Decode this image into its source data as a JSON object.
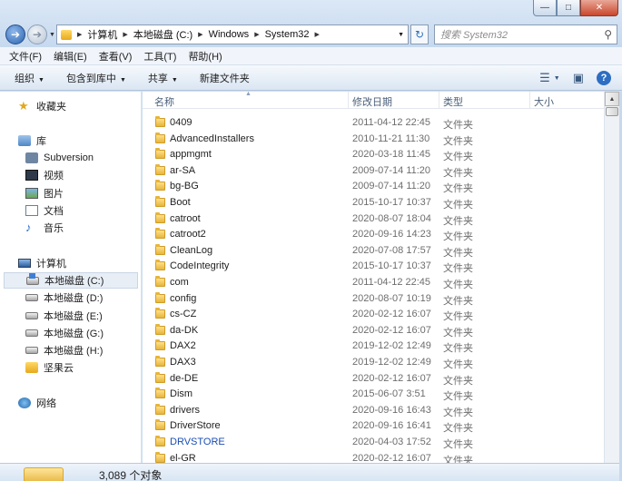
{
  "window": {
    "min_icon": "minimize-icon",
    "max_icon": "maximize-icon",
    "close_icon": "close-icon"
  },
  "address": {
    "crumbs": [
      "计算机",
      "本地磁盘 (C:)",
      "Windows",
      "System32"
    ]
  },
  "search": {
    "placeholder": "搜索 System32"
  },
  "menu": [
    "文件(F)",
    "编辑(E)",
    "查看(V)",
    "工具(T)",
    "帮助(H)"
  ],
  "commands": {
    "organize": "组织",
    "include": "包含到库中",
    "share": "共享",
    "new_folder": "新建文件夹"
  },
  "nav": {
    "favorites": "收藏夹",
    "libraries": "库",
    "lib_items": [
      "Subversion",
      "视频",
      "图片",
      "文档",
      "音乐"
    ],
    "computer": "计算机",
    "drives": [
      "本地磁盘 (C:)",
      "本地磁盘 (D:)",
      "本地磁盘 (E:)",
      "本地磁盘 (G:)",
      "本地磁盘 (H:)"
    ],
    "jianguo": "坚果云",
    "network": "网络"
  },
  "columns": {
    "name": "名称",
    "date": "修改日期",
    "type": "类型",
    "size": "大小"
  },
  "files": [
    {
      "name": "0409",
      "date": "2011-04-12 22:45",
      "type": "文件夹"
    },
    {
      "name": "AdvancedInstallers",
      "date": "2010-11-21 11:30",
      "type": "文件夹"
    },
    {
      "name": "appmgmt",
      "date": "2020-03-18 11:45",
      "type": "文件夹"
    },
    {
      "name": "ar-SA",
      "date": "2009-07-14 11:20",
      "type": "文件夹"
    },
    {
      "name": "bg-BG",
      "date": "2009-07-14 11:20",
      "type": "文件夹"
    },
    {
      "name": "Boot",
      "date": "2015-10-17 10:37",
      "type": "文件夹"
    },
    {
      "name": "catroot",
      "date": "2020-08-07 18:04",
      "type": "文件夹"
    },
    {
      "name": "catroot2",
      "date": "2020-09-16 14:23",
      "type": "文件夹"
    },
    {
      "name": "CleanLog",
      "date": "2020-07-08 17:57",
      "type": "文件夹"
    },
    {
      "name": "CodeIntegrity",
      "date": "2015-10-17 10:37",
      "type": "文件夹"
    },
    {
      "name": "com",
      "date": "2011-04-12 22:45",
      "type": "文件夹"
    },
    {
      "name": "config",
      "date": "2020-08-07 10:19",
      "type": "文件夹"
    },
    {
      "name": "cs-CZ",
      "date": "2020-02-12 16:07",
      "type": "文件夹"
    },
    {
      "name": "da-DK",
      "date": "2020-02-12 16:07",
      "type": "文件夹"
    },
    {
      "name": "DAX2",
      "date": "2019-12-02 12:49",
      "type": "文件夹"
    },
    {
      "name": "DAX3",
      "date": "2019-12-02 12:49",
      "type": "文件夹"
    },
    {
      "name": "de-DE",
      "date": "2020-02-12 16:07",
      "type": "文件夹"
    },
    {
      "name": "Dism",
      "date": "2015-06-07 3:51",
      "type": "文件夹"
    },
    {
      "name": "drivers",
      "date": "2020-09-16 16:43",
      "type": "文件夹"
    },
    {
      "name": "DriverStore",
      "date": "2020-09-16 16:41",
      "type": "文件夹"
    },
    {
      "name": "DRVSTORE",
      "date": "2020-04-03 17:52",
      "type": "文件夹",
      "link": true
    },
    {
      "name": "el-GR",
      "date": "2020-02-12 16:07",
      "type": "文件夹"
    }
  ],
  "status": {
    "count": "3,089 个对象"
  }
}
